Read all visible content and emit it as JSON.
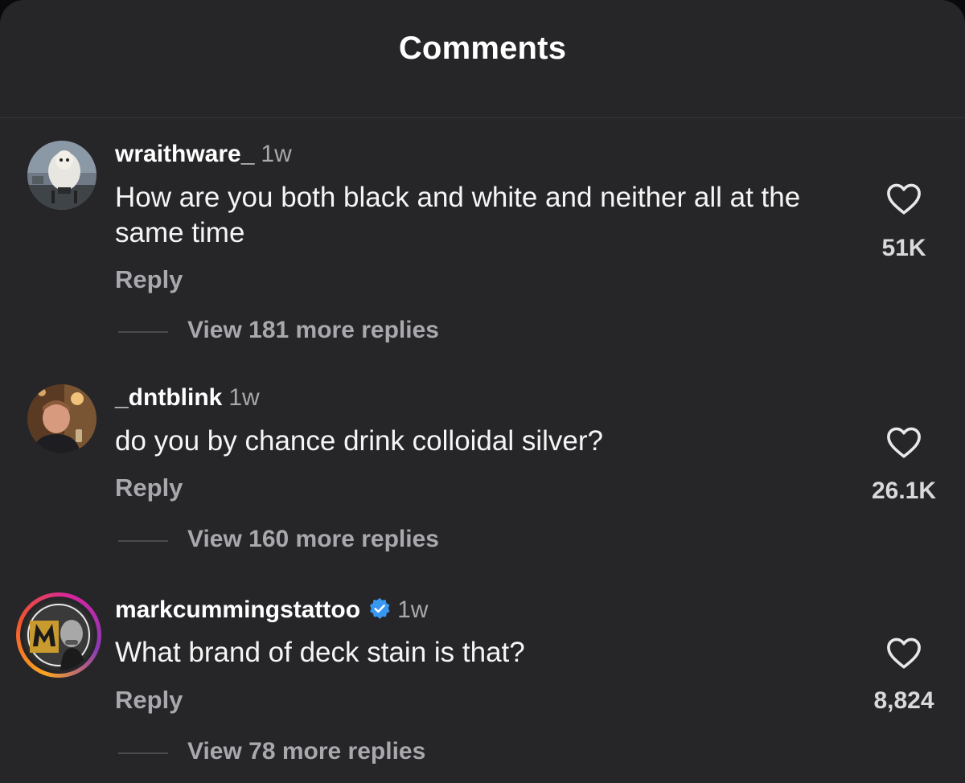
{
  "header": {
    "title": "Comments"
  },
  "comments": [
    {
      "username": "wraithware_",
      "time": "1w",
      "verified": false,
      "text": "How are you both black and white and neither all at the same time",
      "reply_label": "Reply",
      "view_replies": "View 181 more replies",
      "likes": "51K",
      "avatar_icon": "avatar-photo-icon"
    },
    {
      "username": "_dntblink",
      "time": "1w",
      "verified": false,
      "text": "do you by chance drink colloidal silver?",
      "reply_label": "Reply",
      "view_replies": "View 160 more replies",
      "likes": "26.1K",
      "avatar_icon": "avatar-photo-icon"
    },
    {
      "username": "markcummingstattoo",
      "time": "1w",
      "verified": true,
      "has_story": true,
      "text": "What brand of deck stain is that?",
      "reply_label": "Reply",
      "view_replies": "View 78 more replies",
      "likes": "8,824",
      "avatar_icon": "avatar-photo-icon"
    }
  ],
  "icons": {
    "like": "heart-outline-icon",
    "verified": "verified-badge-icon"
  },
  "colors": {
    "background": "#262629",
    "primary_text": "#f5f5f5",
    "secondary_text": "#a8a8ad",
    "verified": "#3897f0"
  }
}
